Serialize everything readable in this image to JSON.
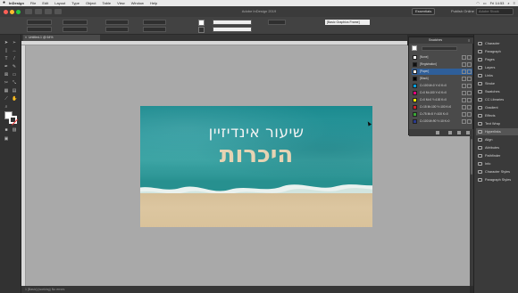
{
  "menubar": {
    "items": [
      "InDesign",
      "File",
      "Edit",
      "Layout",
      "Type",
      "Object",
      "Table",
      "View",
      "Window",
      "Help"
    ],
    "clock": "Fri 14:53"
  },
  "titlebar": {
    "app_title": "Adobe InDesign 2019",
    "essentials": "Essentials",
    "publish": "Publish Online",
    "search_placeholder": "Adobe Stock"
  },
  "controlbar": {
    "paragraph_style": "[Basic Graphics Frame]"
  },
  "document": {
    "tab_label": "Untitled-1 @ 64%"
  },
  "page": {
    "subtitle": "שיעור אינדיזיין",
    "title": "היכרות"
  },
  "statusbar": {
    "text": "1    [Basic] (working)    No errors"
  },
  "swatches_panel": {
    "tab": "Swatches",
    "rows": [
      {
        "name": "[None]",
        "color": "#ffffff"
      },
      {
        "name": "[Registration]",
        "color": "#111111"
      },
      {
        "name": "[Paper]",
        "color": "#ffffff"
      },
      {
        "name": "[Black]",
        "color": "#000000"
      },
      {
        "name": "C=100 M=0 Y=0 K=0",
        "color": "#00a0e0"
      },
      {
        "name": "C=0 M=100 Y=0 K=0",
        "color": "#e2007a"
      },
      {
        "name": "C=0 M=0 Y=100 K=0",
        "color": "#fff200"
      },
      {
        "name": "C=15 M=100 Y=100 K=0",
        "color": "#d2232a"
      },
      {
        "name": "C=75 M=5 Y=100 K=0",
        "color": "#3aa935"
      },
      {
        "name": "C=100 M=90 Y=10 K=0",
        "color": "#2a3a8f"
      }
    ],
    "selected_index": 2
  },
  "dock": {
    "items": [
      "Character",
      "Paragraph",
      "Pages",
      "Layers",
      "Links",
      "Stroke",
      "Swatches",
      "CC Libraries",
      "Gradient",
      "Effects",
      "Text Wrap",
      "Hyperlinks",
      "Align",
      "Attributes",
      "Pathfinder",
      "Info",
      "Character Styles",
      "Paragraph Styles"
    ],
    "active_index": 11
  }
}
